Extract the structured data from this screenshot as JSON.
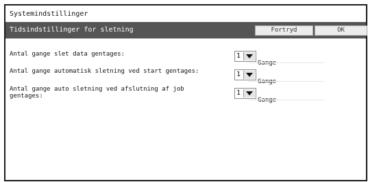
{
  "window": {
    "title": "Systemindstillinger"
  },
  "header": {
    "title": "Tidsindstillinger for sletning",
    "cancel_label": "Fortryd",
    "ok_label": "OK"
  },
  "settings": [
    {
      "label": "Antal gange slet data gentages:",
      "value": "1",
      "unit": "Gange"
    },
    {
      "label": "Antal gange automatisk sletning ved start gentages:",
      "value": "1",
      "unit": "Gange"
    },
    {
      "label": "Antal gange auto sletning ved afslutning af job\ngentages:",
      "value": "1",
      "unit": "Gange"
    }
  ],
  "icons": {
    "dropdown": "chevron-down-icon"
  },
  "colors": {
    "title_bar": "#ffffff",
    "sub_header": "#555555",
    "frame": "#1b1b1b"
  }
}
